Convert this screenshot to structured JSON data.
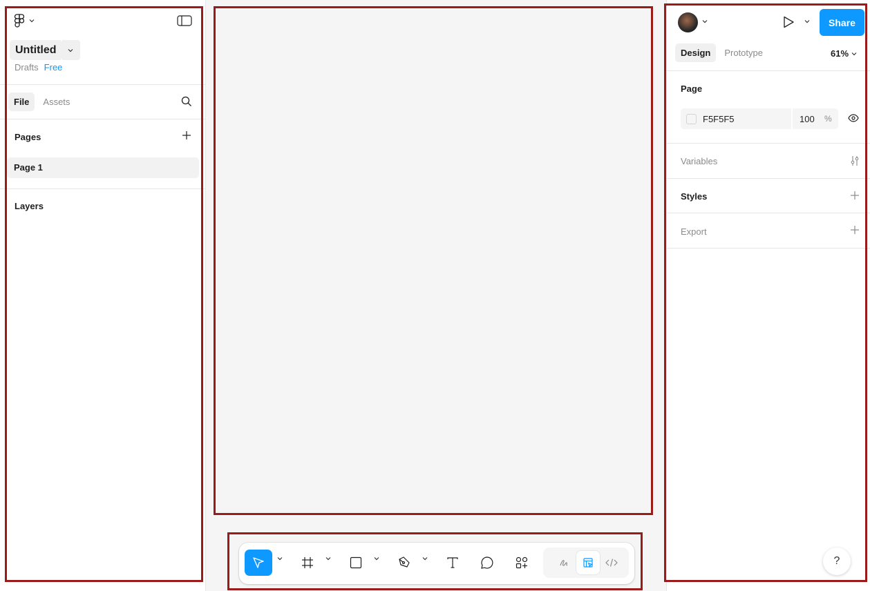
{
  "left": {
    "file_title": "Untitled",
    "location": "Drafts",
    "plan": "Free",
    "tabs": [
      {
        "label": "File"
      },
      {
        "label": "Assets"
      }
    ],
    "pages_header": "Pages",
    "pages": [
      {
        "label": "Page 1"
      }
    ],
    "layers_header": "Layers"
  },
  "right": {
    "share_label": "Share",
    "tabs": [
      {
        "label": "Design"
      },
      {
        "label": "Prototype"
      }
    ],
    "zoom": "61%",
    "page_section": "Page",
    "page_color": "F5F5F5",
    "page_opacity": "100",
    "page_opacity_unit": "%",
    "variables_label": "Variables",
    "styles_label": "Styles",
    "export_label": "Export",
    "help_label": "?"
  },
  "toolbar": {
    "tools": [
      "move",
      "frame",
      "shape",
      "pen",
      "text",
      "comment",
      "actions"
    ],
    "modes": [
      "draw",
      "design",
      "dev"
    ]
  },
  "colors": {
    "accent": "#0d99ff",
    "canvas_bg": "#f5f5f5",
    "highlight_border": "#9b1b1b"
  }
}
